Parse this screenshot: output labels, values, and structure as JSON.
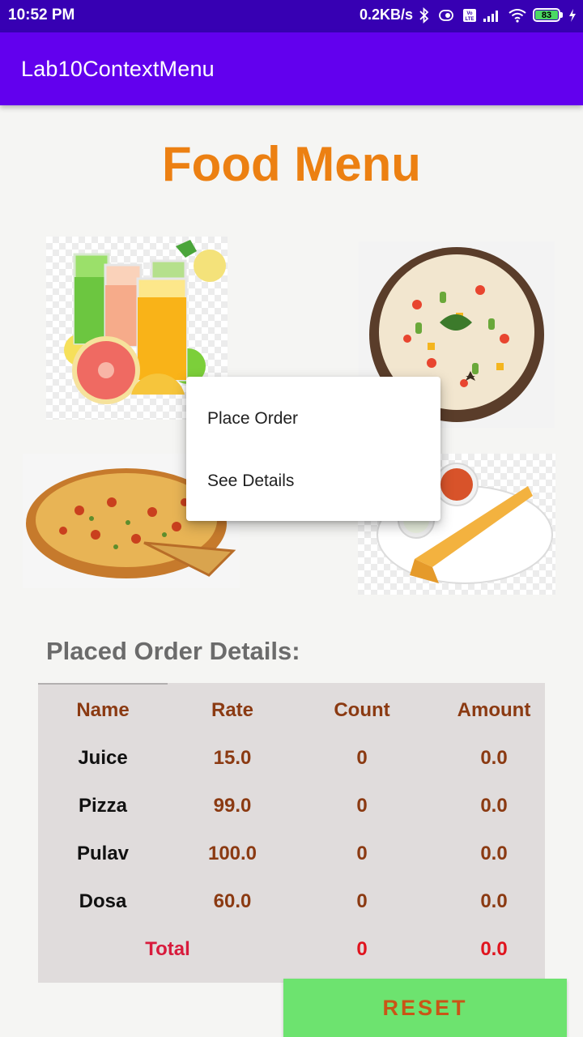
{
  "status_bar": {
    "time": "10:52 PM",
    "network_speed": "0.2KB/s",
    "battery_level": "83",
    "icons": [
      "bluetooth-icon",
      "vibrate-icon",
      "volte-icon",
      "signal-icon",
      "wifi-icon",
      "battery-icon",
      "charging-icon"
    ]
  },
  "app_bar": {
    "title": "Lab10ContextMenu"
  },
  "main": {
    "title": "Food Menu",
    "images": [
      "juice-image",
      "pulav-image",
      "pizza-image",
      "dosa-image"
    ]
  },
  "context_menu": {
    "items": [
      {
        "label": "Place Order"
      },
      {
        "label": "See Details"
      }
    ]
  },
  "orders": {
    "heading": "Placed Order Details:",
    "columns": [
      "Name",
      "Rate",
      "Count",
      "Amount"
    ],
    "rows": [
      {
        "name": "Juice",
        "rate": "15.0",
        "count": "0",
        "amount": "0.0"
      },
      {
        "name": "Pizza",
        "rate": "99.0",
        "count": "0",
        "amount": "0.0"
      },
      {
        "name": "Pulav",
        "rate": "100.0",
        "count": "0",
        "amount": "0.0"
      },
      {
        "name": "Dosa",
        "rate": "60.0",
        "count": "0",
        "amount": "0.0"
      }
    ],
    "total": {
      "label": "Total",
      "count": "0",
      "amount": "0.0"
    }
  },
  "buttons": {
    "reset_label": "RESET"
  },
  "colors": {
    "status_bar": "#3700b3",
    "app_bar": "#6200ee",
    "title": "#ec8012",
    "table_bg": "#e0dcdc",
    "header_text": "#8b3a12",
    "total_text": "#d81b3c",
    "reset_bg": "#6de36f",
    "reset_text": "#c95516"
  }
}
